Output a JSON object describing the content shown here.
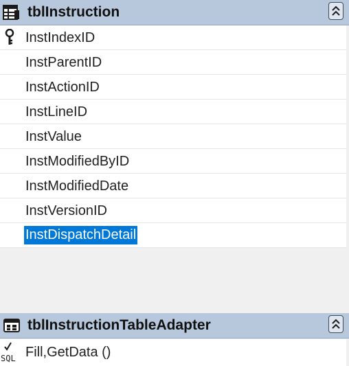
{
  "table_card": {
    "title": "tblInstruction",
    "icon": "table-icon",
    "fields": [
      {
        "label": "InstIndexID",
        "primary_key": true
      },
      {
        "label": "InstParentID"
      },
      {
        "label": "InstActionID"
      },
      {
        "label": "InstLineID"
      },
      {
        "label": "InstValue"
      },
      {
        "label": "InstModifiedByID"
      },
      {
        "label": "InstModifiedDate"
      },
      {
        "label": "InstVersionID"
      },
      {
        "label": "InstDispatchDetail",
        "selected": true
      }
    ]
  },
  "adapter_card": {
    "title": "tblInstructionTableAdapter",
    "icon": "table-adapter-icon",
    "methods": [
      {
        "label": "Fill,GetData ()",
        "icon": "sql-query-icon",
        "icon_text": "SQL"
      }
    ]
  },
  "colors": {
    "header_bg": "#b8c8dc",
    "selection": "#0078d7"
  }
}
